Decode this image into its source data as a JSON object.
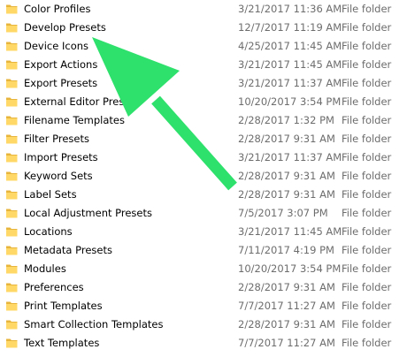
{
  "colors": {
    "arrow": "#2ee06c",
    "folder_front": "#ffd867",
    "folder_back": "#e8b53c",
    "meta_text": "#6d6d6d"
  },
  "icons": {
    "folder": "folder-icon",
    "annotation": "arrow-annotation"
  },
  "files": [
    {
      "name": "Color Profiles",
      "date": "3/21/2017 11:36 AM",
      "type": "File folder"
    },
    {
      "name": "Develop Presets",
      "date": "12/7/2017 11:19 AM",
      "type": "File folder"
    },
    {
      "name": "Device Icons",
      "date": "4/25/2017 11:45 AM",
      "type": "File folder"
    },
    {
      "name": "Export Actions",
      "date": "3/21/2017 11:45 AM",
      "type": "File folder"
    },
    {
      "name": "Export Presets",
      "date": "3/21/2017 11:37 AM",
      "type": "File folder"
    },
    {
      "name": "External Editor Presets",
      "date": "10/20/2017 3:54 PM",
      "type": "File folder"
    },
    {
      "name": "Filename Templates",
      "date": "2/28/2017 1:32 PM",
      "type": "File folder"
    },
    {
      "name": "Filter Presets",
      "date": "2/28/2017 9:31 AM",
      "type": "File folder"
    },
    {
      "name": "Import Presets",
      "date": "3/21/2017 11:37 AM",
      "type": "File folder"
    },
    {
      "name": "Keyword Sets",
      "date": "2/28/2017 9:31 AM",
      "type": "File folder"
    },
    {
      "name": "Label Sets",
      "date": "2/28/2017 9:31 AM",
      "type": "File folder"
    },
    {
      "name": "Local Adjustment Presets",
      "date": "7/5/2017 3:07 PM",
      "type": "File folder"
    },
    {
      "name": "Locations",
      "date": "3/21/2017 11:45 AM",
      "type": "File folder"
    },
    {
      "name": "Metadata Presets",
      "date": "7/11/2017 4:19 PM",
      "type": "File folder"
    },
    {
      "name": "Modules",
      "date": "10/20/2017 3:54 PM",
      "type": "File folder"
    },
    {
      "name": "Preferences",
      "date": "2/28/2017 9:31 AM",
      "type": "File folder"
    },
    {
      "name": "Print Templates",
      "date": "7/7/2017 11:27 AM",
      "type": "File folder"
    },
    {
      "name": "Smart Collection Templates",
      "date": "2/28/2017 9:31 AM",
      "type": "File folder"
    },
    {
      "name": "Text Templates",
      "date": "7/7/2017 11:27 AM",
      "type": "File folder"
    }
  ]
}
